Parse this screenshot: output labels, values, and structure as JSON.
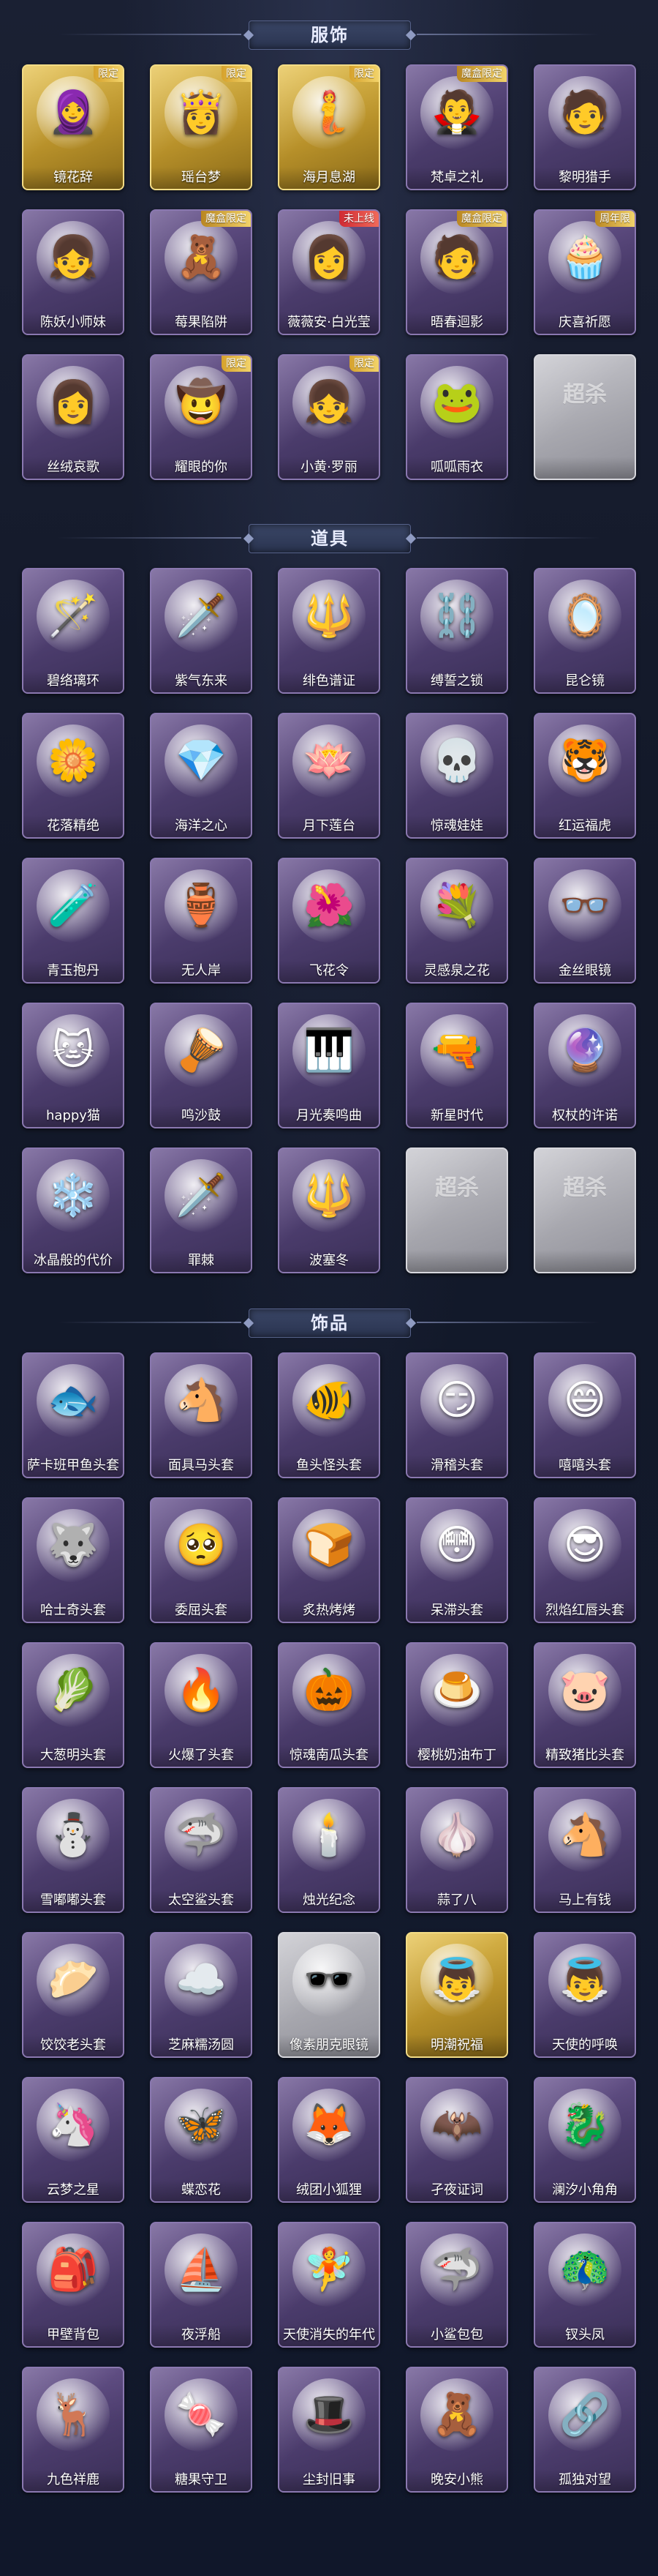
{
  "sections": [
    {
      "id": "costumes",
      "title": "服饰",
      "items": [
        {
          "label": "镜花辞",
          "badge": "限定",
          "tier": "gold",
          "glyph": "🧕"
        },
        {
          "label": "瑶台梦",
          "badge": "限定",
          "tier": "gold",
          "glyph": "👸"
        },
        {
          "label": "海月息湖",
          "badge": "限定",
          "tier": "gold",
          "glyph": "🧜"
        },
        {
          "label": "梵卓之礼",
          "badge": "魔盒限定",
          "tier": "purple",
          "glyph": "🧛"
        },
        {
          "label": "黎明猎手",
          "badge": "",
          "tier": "purple",
          "glyph": "🧑"
        },
        {
          "label": "陈妖小师妹",
          "badge": "",
          "tier": "purple",
          "glyph": "👧"
        },
        {
          "label": "莓果陷阱",
          "badge": "魔盒限定",
          "tier": "purple",
          "glyph": "🧸"
        },
        {
          "label": "薇薇安·白光莹",
          "badge": "未上线",
          "tier": "purple",
          "glyph": "👩"
        },
        {
          "label": "晤春迴影",
          "badge": "魔盒限定",
          "tier": "purple",
          "glyph": "🧑"
        },
        {
          "label": "庆喜祈愿",
          "badge": "周年限",
          "tier": "purple",
          "glyph": "🧁"
        },
        {
          "label": "丝绒哀歌",
          "badge": "",
          "tier": "purple",
          "glyph": "👩"
        },
        {
          "label": "耀眼的你",
          "badge": "限定",
          "tier": "purple",
          "glyph": "🤠"
        },
        {
          "label": "小黄·罗丽",
          "badge": "限定",
          "tier": "purple",
          "glyph": "👧"
        },
        {
          "label": "呱呱雨衣",
          "badge": "",
          "tier": "purple",
          "glyph": "🐸"
        },
        {
          "label": "",
          "badge": "",
          "tier": "gray",
          "glyph": "",
          "empty_mark": "超杀",
          "empty_sub": ""
        }
      ]
    },
    {
      "id": "props",
      "title": "道具",
      "items": [
        {
          "label": "碧络璃环",
          "badge": "",
          "tier": "purple",
          "glyph": "🪄"
        },
        {
          "label": "紫气东来",
          "badge": "",
          "tier": "purple",
          "glyph": "🗡️"
        },
        {
          "label": "绯色谱证",
          "badge": "",
          "tier": "purple",
          "glyph": "🔱"
        },
        {
          "label": "缚誓之锁",
          "badge": "",
          "tier": "purple",
          "glyph": "⛓️"
        },
        {
          "label": "昆仑镜",
          "badge": "",
          "tier": "purple",
          "glyph": "🪞"
        },
        {
          "label": "花落精绝",
          "badge": "",
          "tier": "purple",
          "glyph": "🌼"
        },
        {
          "label": "海洋之心",
          "badge": "",
          "tier": "purple",
          "glyph": "💎"
        },
        {
          "label": "月下莲台",
          "badge": "",
          "tier": "purple",
          "glyph": "🪷"
        },
        {
          "label": "惊魂娃娃",
          "badge": "",
          "tier": "purple",
          "glyph": "💀"
        },
        {
          "label": "红运福虎",
          "badge": "",
          "tier": "purple",
          "glyph": "🐯"
        },
        {
          "label": "青玉抱丹",
          "badge": "",
          "tier": "purple",
          "glyph": "🧪"
        },
        {
          "label": "无人岸",
          "badge": "",
          "tier": "purple",
          "glyph": "🏺"
        },
        {
          "label": "飞花令",
          "badge": "",
          "tier": "purple",
          "glyph": "🌺"
        },
        {
          "label": "灵感泉之花",
          "badge": "",
          "tier": "purple",
          "glyph": "💐"
        },
        {
          "label": "金丝眼镜",
          "badge": "",
          "tier": "purple",
          "glyph": "👓"
        },
        {
          "label": "happy猫",
          "badge": "",
          "tier": "purple",
          "glyph": "🐱"
        },
        {
          "label": "鸣沙鼓",
          "badge": "",
          "tier": "purple",
          "glyph": "🪘"
        },
        {
          "label": "月光奏鸣曲",
          "badge": "",
          "tier": "purple",
          "glyph": "🎹"
        },
        {
          "label": "新星时代",
          "badge": "",
          "tier": "purple",
          "glyph": "🔫"
        },
        {
          "label": "权杖的许诺",
          "badge": "",
          "tier": "purple",
          "glyph": "🔮"
        },
        {
          "label": "冰晶般的代价",
          "badge": "",
          "tier": "purple",
          "glyph": "❄️"
        },
        {
          "label": "罪棘",
          "badge": "",
          "tier": "purple",
          "glyph": "🗡️"
        },
        {
          "label": "波塞冬",
          "badge": "",
          "tier": "purple",
          "glyph": "🔱"
        },
        {
          "label": "",
          "badge": "",
          "tier": "gray",
          "glyph": "",
          "empty_mark": "超杀",
          "empty_sub": ""
        },
        {
          "label": "",
          "badge": "",
          "tier": "gray",
          "glyph": "",
          "empty_mark": "超杀",
          "empty_sub": ""
        }
      ]
    },
    {
      "id": "accessories",
      "title": "饰品",
      "items": [
        {
          "label": "萨卡班甲鱼头套",
          "badge": "",
          "tier": "purple",
          "glyph": "🐟"
        },
        {
          "label": "面具马头套",
          "badge": "",
          "tier": "purple",
          "glyph": "🐴"
        },
        {
          "label": "鱼头怪头套",
          "badge": "",
          "tier": "purple",
          "glyph": "🐠"
        },
        {
          "label": "滑稽头套",
          "badge": "",
          "tier": "purple",
          "glyph": "😏"
        },
        {
          "label": "嘻嘻头套",
          "badge": "",
          "tier": "purple",
          "glyph": "😄"
        },
        {
          "label": "哈士奇头套",
          "badge": "",
          "tier": "purple",
          "glyph": "🐺"
        },
        {
          "label": "委屈头套",
          "badge": "",
          "tier": "purple",
          "glyph": "🥺"
        },
        {
          "label": "炙热烤烤",
          "badge": "",
          "tier": "purple",
          "glyph": "🍞"
        },
        {
          "label": "呆滞头套",
          "badge": "",
          "tier": "purple",
          "glyph": "😳"
        },
        {
          "label": "烈焰红唇头套",
          "badge": "",
          "tier": "purple",
          "glyph": "😎"
        },
        {
          "label": "大葱明头套",
          "badge": "",
          "tier": "purple",
          "glyph": "🥬"
        },
        {
          "label": "火爆了头套",
          "badge": "",
          "tier": "purple",
          "glyph": "🔥"
        },
        {
          "label": "惊魂南瓜头套",
          "badge": "",
          "tier": "purple",
          "glyph": "🎃"
        },
        {
          "label": "樱桃奶油布丁",
          "badge": "",
          "tier": "purple",
          "glyph": "🍮"
        },
        {
          "label": "精致猪比头套",
          "badge": "",
          "tier": "purple",
          "glyph": "🐷"
        },
        {
          "label": "雪嘟嘟头套",
          "badge": "",
          "tier": "purple",
          "glyph": "⛄"
        },
        {
          "label": "太空鲨头套",
          "badge": "",
          "tier": "purple",
          "glyph": "🦈"
        },
        {
          "label": "烛光纪念",
          "badge": "",
          "tier": "purple",
          "glyph": "🕯️"
        },
        {
          "label": "蒜了八",
          "badge": "",
          "tier": "purple",
          "glyph": "🧄"
        },
        {
          "label": "马上有钱",
          "badge": "",
          "tier": "purple",
          "glyph": "🐴"
        },
        {
          "label": "饺饺老头套",
          "badge": "",
          "tier": "purple",
          "glyph": "🥟"
        },
        {
          "label": "芝麻糯汤圆",
          "badge": "",
          "tier": "purple",
          "glyph": "☁️"
        },
        {
          "label": "像素朋克眼镜",
          "badge": "",
          "tier": "gray",
          "glyph": "🕶️"
        },
        {
          "label": "明潮祝福",
          "badge": "",
          "tier": "gold",
          "glyph": "👼"
        },
        {
          "label": "天使的呼唤",
          "badge": "",
          "tier": "purple",
          "glyph": "👼"
        },
        {
          "label": "云梦之星",
          "badge": "",
          "tier": "purple",
          "glyph": "🦄"
        },
        {
          "label": "蝶恋花",
          "badge": "",
          "tier": "purple",
          "glyph": "🦋"
        },
        {
          "label": "绒团小狐狸",
          "badge": "",
          "tier": "purple",
          "glyph": "🦊"
        },
        {
          "label": "孑夜证词",
          "badge": "",
          "tier": "purple",
          "glyph": "🦇"
        },
        {
          "label": "澜汐小角角",
          "badge": "",
          "tier": "purple",
          "glyph": "🐉"
        },
        {
          "label": "甲壁背包",
          "badge": "",
          "tier": "purple",
          "glyph": "🎒"
        },
        {
          "label": "夜浮船",
          "badge": "",
          "tier": "purple",
          "glyph": "⛵"
        },
        {
          "label": "天使消失的年代",
          "badge": "",
          "tier": "purple",
          "glyph": "🧚"
        },
        {
          "label": "小鲨包包",
          "badge": "",
          "tier": "purple",
          "glyph": "🦈"
        },
        {
          "label": "钗头凤",
          "badge": "",
          "tier": "purple",
          "glyph": "🦚"
        },
        {
          "label": "九色祥鹿",
          "badge": "",
          "tier": "purple",
          "glyph": "🦌"
        },
        {
          "label": "糖果守卫",
          "badge": "",
          "tier": "purple",
          "glyph": "🍬"
        },
        {
          "label": "尘封旧事",
          "badge": "",
          "tier": "purple",
          "glyph": "🎩"
        },
        {
          "label": "晚安小熊",
          "badge": "",
          "tier": "purple",
          "glyph": "🧸"
        },
        {
          "label": "孤独对望",
          "badge": "",
          "tier": "purple",
          "glyph": "🔗"
        }
      ]
    }
  ]
}
